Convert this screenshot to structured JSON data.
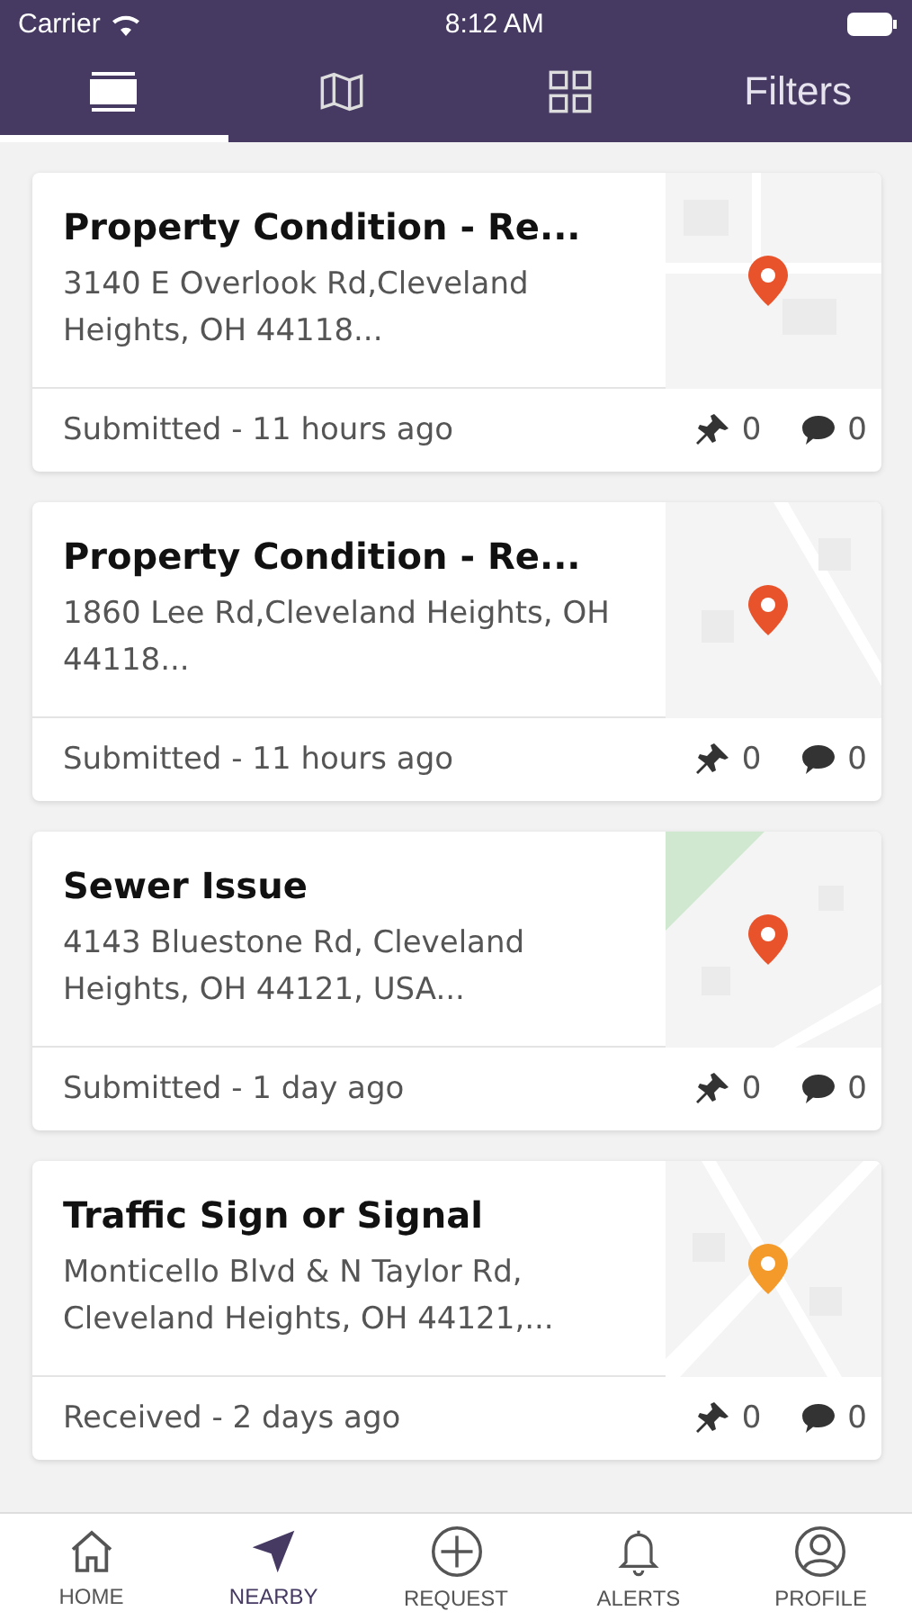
{
  "status_bar": {
    "carrier": "Carrier",
    "time": "8:12 AM"
  },
  "top_tabs": [
    {
      "kind": "list",
      "selected": true
    },
    {
      "kind": "map",
      "selected": false
    },
    {
      "kind": "grid",
      "selected": false
    },
    {
      "kind": "text",
      "label": "Filters",
      "selected": false
    }
  ],
  "reports": [
    {
      "title": "Property Condition - Re...",
      "address": "3140 E Overlook Rd,Cleveland Heights, OH 44118...",
      "status": "Submitted - 11 hours ago",
      "pins": "0",
      "comments": "0",
      "kind": "streets",
      "color": "#e8532b"
    },
    {
      "title": "Property Condition - Re...",
      "address": "1860 Lee Rd,Cleveland Heights, OH 44118...",
      "status": "Submitted - 11 hours ago",
      "pins": "0",
      "comments": "0",
      "kind": "road",
      "color": "#e8532b"
    },
    {
      "title": "Sewer Issue",
      "address": "4143 Bluestone Rd, Cleveland Heights, OH 44121, USA...",
      "status": "Submitted - 1 day ago",
      "pins": "0",
      "comments": "0",
      "kind": "park",
      "color": "#e8532b"
    },
    {
      "title": "Traffic Sign or Signal",
      "address": "Monticello Blvd & N Taylor Rd, Cleveland Heights, OH 44121,...",
      "status": "Received - 2 days ago",
      "pins": "0",
      "comments": "0",
      "kind": "cross",
      "color": "#f39a2b"
    }
  ],
  "bottom_nav": [
    {
      "kind": "home",
      "label": "HOME",
      "selected": false
    },
    {
      "kind": "nearby",
      "label": "NEARBY",
      "selected": true
    },
    {
      "kind": "request",
      "label": "REQUEST",
      "selected": false
    },
    {
      "kind": "alerts",
      "label": "ALERTS",
      "selected": false
    },
    {
      "kind": "profile",
      "label": "PROFILE",
      "selected": false
    }
  ]
}
